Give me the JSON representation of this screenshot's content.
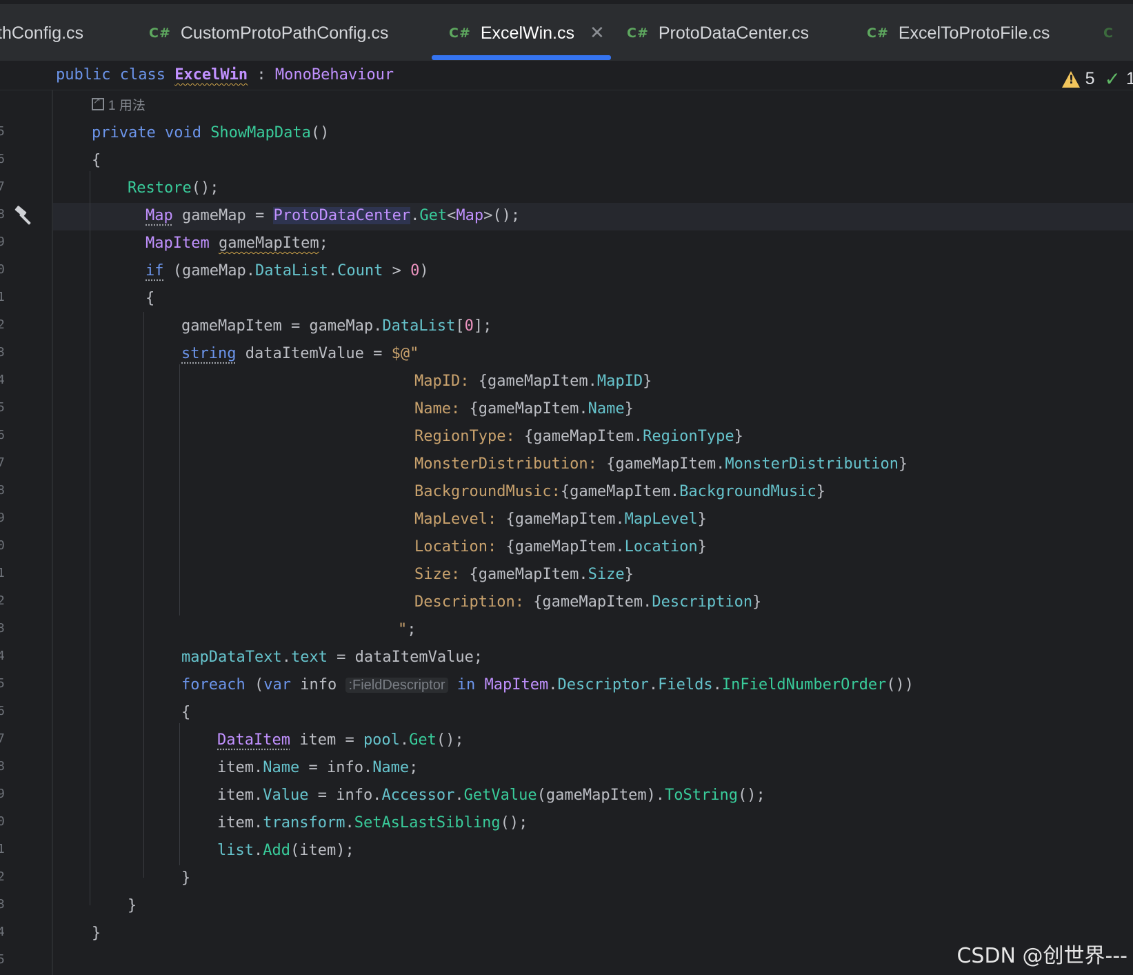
{
  "tabs": [
    {
      "lang": "",
      "name": "thConfig.cs"
    },
    {
      "lang": "C#",
      "name": "CustomProtoPathConfig.cs"
    },
    {
      "lang": "C#",
      "name": "ExcelWin.cs",
      "close": "✕"
    },
    {
      "lang": "C#",
      "name": "ProtoDataCenter.cs"
    },
    {
      "lang": "C#",
      "name": "ExcelToProtoFile.cs"
    },
    {
      "lang": "C",
      "name": ""
    }
  ],
  "inspection": {
    "warnings": "5",
    "ok": "1"
  },
  "usage_hint": "1 用法",
  "param_hint": ":FieldDescriptor",
  "gutter_numbers": [
    "5",
    "5",
    "6",
    "7",
    "8",
    "9",
    "0",
    "1",
    "2",
    "3",
    "4",
    "5",
    "6",
    "7",
    "8",
    "9",
    "0",
    "1",
    "2",
    "3",
    "4",
    "5",
    "6",
    "7",
    "8",
    "9",
    "0",
    "1",
    "2",
    "3",
    "4",
    "5"
  ],
  "code": {
    "l0": {
      "a": "public class ",
      "b": "ExcelWin",
      "c": " : ",
      "d": "MonoBehaviour"
    },
    "l1": {
      "a": "private void ",
      "b": "ShowMapData",
      "c": "()"
    },
    "l2": "{",
    "l3": {
      "a": "Restore",
      "b": "();"
    },
    "l4": {
      "a": "Map",
      "b": " gameMap = ",
      "c": "ProtoDataCenter",
      "d": ".",
      "e": "Get",
      "f": "<",
      "g": "Map",
      "h": ">();"
    },
    "l5": {
      "a": "MapItem",
      "b": " ",
      "c": "gameMapItem",
      "d": ";"
    },
    "l6": {
      "a": "if",
      "b": " (gameMap.",
      "c": "DataList",
      "d": ".",
      "e": "Count",
      "f": " > ",
      "g": "0",
      "h": ")"
    },
    "l7": "{",
    "l8": {
      "a": "gameMapItem = gameMap.",
      "b": "DataList",
      "c": "[",
      "d": "0",
      "e": "];"
    },
    "l9": {
      "a": "string",
      "b": " dataItemValue = ",
      "c": "$@\""
    },
    "fields": [
      {
        "k": "MapID: ",
        "p": "MapID"
      },
      {
        "k": "Name: ",
        "p": "Name"
      },
      {
        "k": "RegionType: ",
        "p": "RegionType"
      },
      {
        "k": "MonsterDistribution: ",
        "p": "MonsterDistribution"
      },
      {
        "k": "BackgroundMusic:",
        "p": "BackgroundMusic"
      },
      {
        "k": "MapLevel: ",
        "p": "MapLevel"
      },
      {
        "k": "Location: ",
        "p": "Location"
      },
      {
        "k": "Size: ",
        "p": "Size"
      },
      {
        "k": "Description: ",
        "p": "Description"
      }
    ],
    "field_open": "{gameMapItem.",
    "field_close": "}",
    "l19": {
      "a": "\"",
      "b": ";"
    },
    "l20": {
      "a": "mapDataText",
      "b": ".",
      "c": "text",
      "d": " = dataItemValue;"
    },
    "l21": {
      "a": "foreach",
      "b": " (",
      "c": "var",
      "d": " info ",
      "e": " in ",
      "f": "MapItem",
      "g": ".",
      "h": "Descriptor",
      "i": ".",
      "j": "Fields",
      "k": ".",
      "l": "InFieldNumberOrder",
      "m": "())"
    },
    "l22": "{",
    "l23": {
      "a": "DataItem",
      "b": " item = ",
      "c": "pool",
      "d": ".",
      "e": "Get",
      "f": "();"
    },
    "l24": {
      "a": "item.",
      "b": "Name",
      "c": " = info.",
      "d": "Name",
      "e": ";"
    },
    "l25": {
      "a": "item.",
      "b": "Value",
      "c": " = info.",
      "d": "Accessor",
      "e": ".",
      "f": "GetValue",
      "g": "(gameMapItem).",
      "h": "ToString",
      "i": "();"
    },
    "l26": {
      "a": "item.",
      "b": "transform",
      "c": ".",
      "d": "SetAsLastSibling",
      "e": "();"
    },
    "l27": {
      "a": "list",
      "b": ".",
      "c": "Add",
      "d": "(item);"
    },
    "l28": "}",
    "l29": "}",
    "l30": "}"
  },
  "watermark": "CSDN @创世界---"
}
